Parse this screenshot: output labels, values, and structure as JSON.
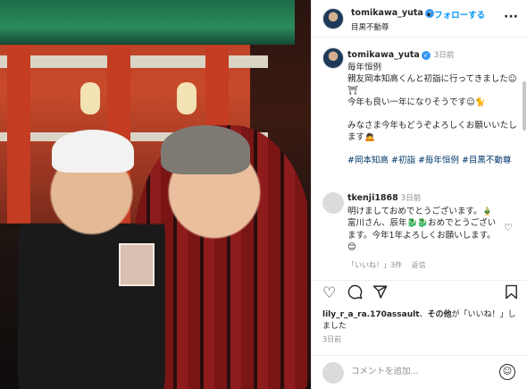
{
  "post": {
    "username": "tomikawa_yuta",
    "verified_mark": "✓",
    "follow_label": "フォローする",
    "separator": "•",
    "location": "目黒不動尊",
    "more": "···"
  },
  "caption": {
    "username": "tomikawa_yuta",
    "time": "3日前",
    "lines": [
      "毎年恒例",
      "親友岡本知高くんと初詣に行ってきました☺⛩",
      "今年も良い一年になりそうです☺🐈",
      "",
      "みなさま今年もどうぞよろしくお願いいたします🙇",
      "",
      "#岡本知高 #初詣 #毎年恒例 #目黒不動尊"
    ]
  },
  "comment": {
    "username": "tkenji1868",
    "time": "3日前",
    "text": "明けましておめでとうございます。🎍富川さん、辰年🐉🐉おめでとうございます。今年1年よろしくお願いします。😊",
    "likes_label": "「いいね！」3件",
    "reply_label": "返信"
  },
  "actions": {
    "likes_user": "lily_r_a_ra.170assault",
    "likes_text_connector": "、",
    "likes_others": "その他",
    "likes_suffix": "が「いいね！」しました",
    "time_ago": "3日前"
  },
  "comment_box": {
    "placeholder": "コメントを追加..."
  },
  "icons": {
    "heart": "heart-icon",
    "comment": "comment-icon",
    "share": "share-icon",
    "bookmark": "bookmark-icon",
    "emoji": "emoji-icon"
  },
  "colors": {
    "link": "#0095f6",
    "hashtag": "#00376b",
    "muted": "#8e8e8e",
    "verified": "#3897f0"
  }
}
